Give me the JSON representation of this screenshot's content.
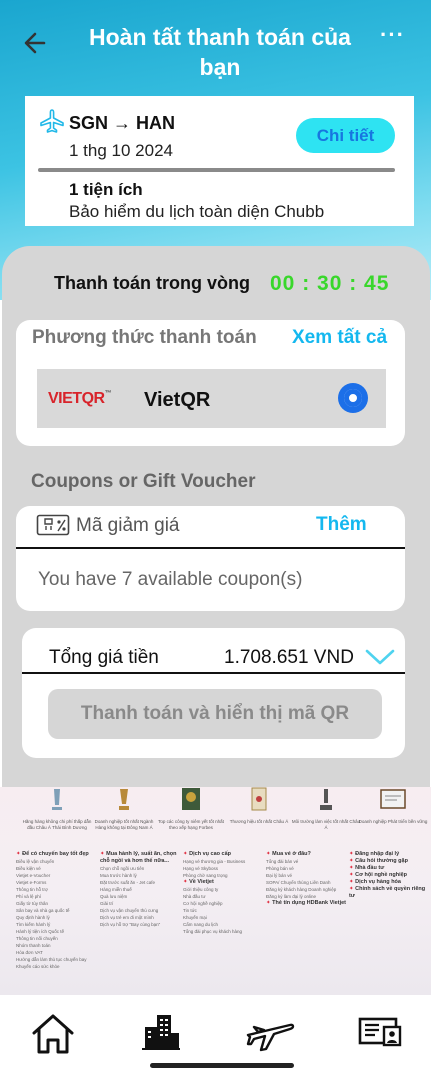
{
  "header": {
    "title": "Hoàn tất thanh toán của bạn",
    "more_label": "···"
  },
  "flight": {
    "route_from": "SGN",
    "route_arrow": "→",
    "route_to": "HAN",
    "date": "1 thg 10 2024",
    "detail_label": "Chi tiết",
    "extras_count": "1 tiện ích",
    "extras_name": "Bảo hiểm du lịch toàn diện Chubb"
  },
  "countdown": {
    "label": "Thanh toán trong vòng",
    "time": "00 : 30 : 45"
  },
  "payment": {
    "heading": "Phương thức thanh toán",
    "see_all": "Xem tất cả",
    "method_logo": "VIETQR",
    "method_logo_tm": "™",
    "method_name": "VietQR"
  },
  "coupons": {
    "heading": "Coupons or Gift Voucher",
    "placeholder": "Mã giảm giá",
    "add_label": "Thêm",
    "available": "You have 7 available coupon(s)"
  },
  "total": {
    "label": "Tổng giá tiền",
    "value": "1.708.651 VND",
    "pay_label": "Thanh toán và hiển thị mã QR"
  },
  "footer": {
    "awards": [
      "Hãng hàng không chi phí thấp dẫn đầu Châu Á Thái Bình Dương",
      "Doanh nghiệp tốt nhất Ngành Hàng không tại Đông Nam Á",
      "Top các công ty niêm yết tốt nhất theo xếp hạng Forbes",
      "Thương hiệu tốt nhất Châu Á",
      "Môi trường làm việc tốt nhất Châu Á",
      "Doanh nghiệp Phát triển bền vững"
    ],
    "columns": [
      {
        "heading": "Để có chuyến bay tốt đẹp",
        "items": [
          "Điều lệ vận chuyển",
          "Điều kiện vé",
          "Vietjet e-Voucher",
          "Vietjet e-Forms",
          "Thông tin hỗ trợ",
          "Phí và lệ phí",
          "Giấy tờ tùy thân",
          "Sân bay và nhà ga quốc tế",
          "Quy định hành lý",
          "Tìm kiếm hành lý",
          "Hành lý tiện ích Quốc tế",
          "Thông tin nối chuyến",
          "Nhóm thanh toán",
          "Hóa đơn VAT",
          "Hướng dẫn làm thủ tục chuyến bay",
          "Khuyến cáo sức khỏe"
        ]
      },
      {
        "heading": "Mua hành lý, suất ăn, chọn chỗ ngồi và hơn thế nữa...",
        "items": [
          "Chọn chỗ ngồi ưu tiên",
          "Mua trước hành lý",
          "Đặt trước suất ăn - Jet cafe",
          "Hàng miễn thuế",
          "Quà lưu niệm",
          "Giải trí",
          "Dịch vụ vận chuyển thú cưng",
          "Dịch vụ trẻ em đi một mình",
          "Dịch vụ hỗ trợ \"Bay cùng bạn\""
        ]
      },
      {
        "heading": "Dịch vụ cao cấp",
        "items": [
          "Hạng vé thương gia - Business",
          "Hạng vé Skyboss",
          "Phòng chờ sang trọng"
        ],
        "heading2": "Về Vietjet",
        "items2": [
          "Giới thiệu công ty",
          "Nhà đầu tư",
          "Cơ hội nghề nghiệp",
          "Tin tức",
          "Khuyến mại",
          "Cẩm nang du lịch",
          "Tổng đài phục vụ khách hàng"
        ]
      },
      {
        "heading": "Mua vé ở đâu?",
        "items": [
          "Tổng đài bán vé",
          "Phòng bán vé",
          "Đại lý bán vé",
          "SOPA/ Chuyển thùng Liên Danh",
          "Đăng ký khách hàng Doanh nghiệp",
          "Đăng ký làm đại lý online"
        ],
        "heading2": "Thẻ tín dụng HDBank Vietjet",
        "items2": []
      },
      {
        "heading": "Đăng nhập đại lý",
        "items": [],
        "extra_headings": [
          "Câu hỏi thường gặp",
          "Nhà đầu tư",
          "Cơ hội nghề nghiệp",
          "Dịch vụ hàng hóa",
          "Chính sách về quyền riêng tư"
        ]
      }
    ]
  },
  "nav": {
    "items": [
      "home-icon",
      "building-icon",
      "airplane-icon",
      "ticket-icon"
    ]
  },
  "colors": {
    "accent": "#14b8ef",
    "countdown": "#39d72b",
    "radio": "#1c6fe8",
    "brand_red": "#d8242b"
  }
}
